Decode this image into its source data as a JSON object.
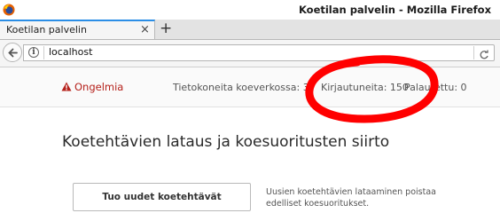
{
  "window": {
    "title": "Koetilan palvelin - Mozilla Firefox",
    "app_icon": "firefox-icon"
  },
  "tabs": [
    {
      "label": "Koetilan palvelin",
      "active": true,
      "close_icon": "close-icon"
    }
  ],
  "new_tab_label": "+",
  "navbar": {
    "back_icon": "back-arrow-icon",
    "info_icon": "info-icon",
    "info_glyph": "i",
    "url": "localhost",
    "reload_icon": "reload-icon"
  },
  "status": {
    "problem_label": "Ongelmia",
    "problem_icon": "warning-icon",
    "computers": "Tietokoneita koeverkossa: 3",
    "logged_in": "Kirjautuneita: 150",
    "answers": "Palautettu: 0"
  },
  "main": {
    "heading": "Koetehtävien lataus ja koesuoritusten siirto",
    "load_button_label": "Tuo uudet koetehtävät",
    "load_note": "Uusien koetehtävien lataaminen poistaa edelliset koesuoritukset."
  },
  "colors": {
    "tab_accent": "#2b8ee6",
    "problem": "#b5211b",
    "annotation": "#ff0000"
  }
}
